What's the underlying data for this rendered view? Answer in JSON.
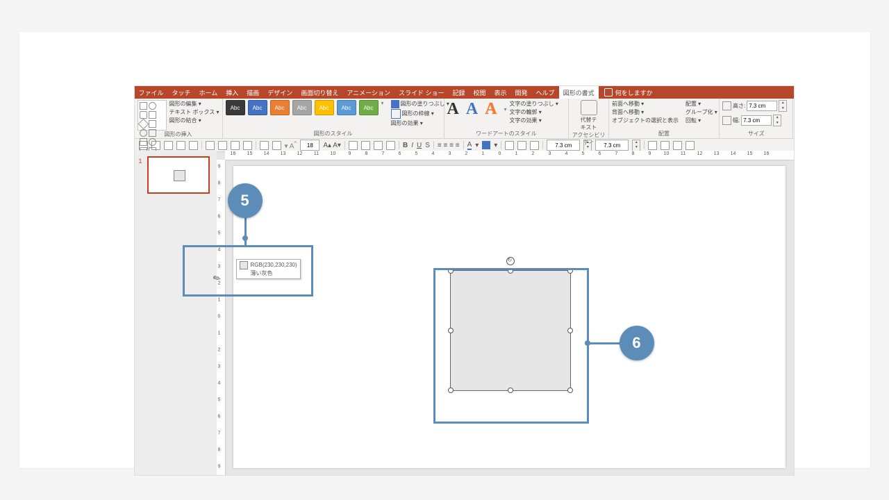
{
  "tabs": [
    "ファイル",
    "タッチ",
    "ホーム",
    "挿入",
    "描画",
    "デザイン",
    "画面切り替え",
    "アニメーション",
    "スライド ショー",
    "記録",
    "校閲",
    "表示",
    "開発",
    "ヘルプ",
    "図形の書式"
  ],
  "activeTab": "図形の書式",
  "tellme": "何をしますか",
  "groups": {
    "insert": {
      "label": "図形の挿入",
      "edit": "図形の編集 ▾",
      "textbox": "テキスト ボックス ▾",
      "merge": "図形の結合 ▾"
    },
    "styles": {
      "label": "図形のスタイル",
      "fill": "図形の塗りつぶし ▾",
      "outline": "図形の枠線 ▾",
      "effects": "図形の効果 ▾"
    },
    "wordart": {
      "label": "ワードアートのスタイル",
      "fill": "文字の塗りつぶし ▾",
      "outline": "文字の輪郭 ▾",
      "effects": "文字の効果 ▾"
    },
    "acc": {
      "label": "アクセシビリティ",
      "alt": "代替テキスト"
    },
    "arrange": {
      "label": "配置",
      "front": "前面へ移動 ▾",
      "back": "背面へ移動 ▾",
      "selpane": "オブジェクトの選択と表示",
      "align": "配置 ▾",
      "group": "グループ化 ▾",
      "rotate": "回転 ▾"
    },
    "size": {
      "label": "サイズ",
      "h": "高さ:",
      "hv": "7.3 cm",
      "w": "幅:",
      "wv": "7.3 cm"
    }
  },
  "stylechips": [
    {
      "bg": "#3a3a3a",
      "txt": "Abc"
    },
    {
      "bg": "#4472c4",
      "txt": "Abc"
    },
    {
      "bg": "#ed7d31",
      "txt": "Abc"
    },
    {
      "bg": "#a5a5a5",
      "txt": "Abc"
    },
    {
      "bg": "#ffc000",
      "txt": "Abc"
    },
    {
      "bg": "#5b9bd5",
      "txt": "Abc"
    },
    {
      "bg": "#70ad47",
      "txt": "Abc"
    }
  ],
  "qat": {
    "fontsize": "18",
    "posX": "7.3 cm",
    "posY": "7.3 cm"
  },
  "thumb": {
    "num": "1"
  },
  "tooltip": {
    "rgb": "RGB(230,230,230)",
    "name": "薄い灰色"
  },
  "callouts": {
    "c5": "5",
    "c6": "6"
  },
  "rulerH": [
    16,
    15,
    14,
    13,
    12,
    11,
    10,
    9,
    8,
    7,
    6,
    5,
    4,
    3,
    2,
    1,
    0,
    1,
    2,
    3,
    4,
    5,
    6,
    7,
    8,
    9,
    10,
    11,
    12,
    13,
    14,
    15,
    16
  ],
  "rulerV": [
    9,
    8,
    7,
    6,
    5,
    4,
    3,
    2,
    1,
    0,
    1,
    2,
    3,
    4,
    5,
    6,
    7,
    8,
    9
  ]
}
